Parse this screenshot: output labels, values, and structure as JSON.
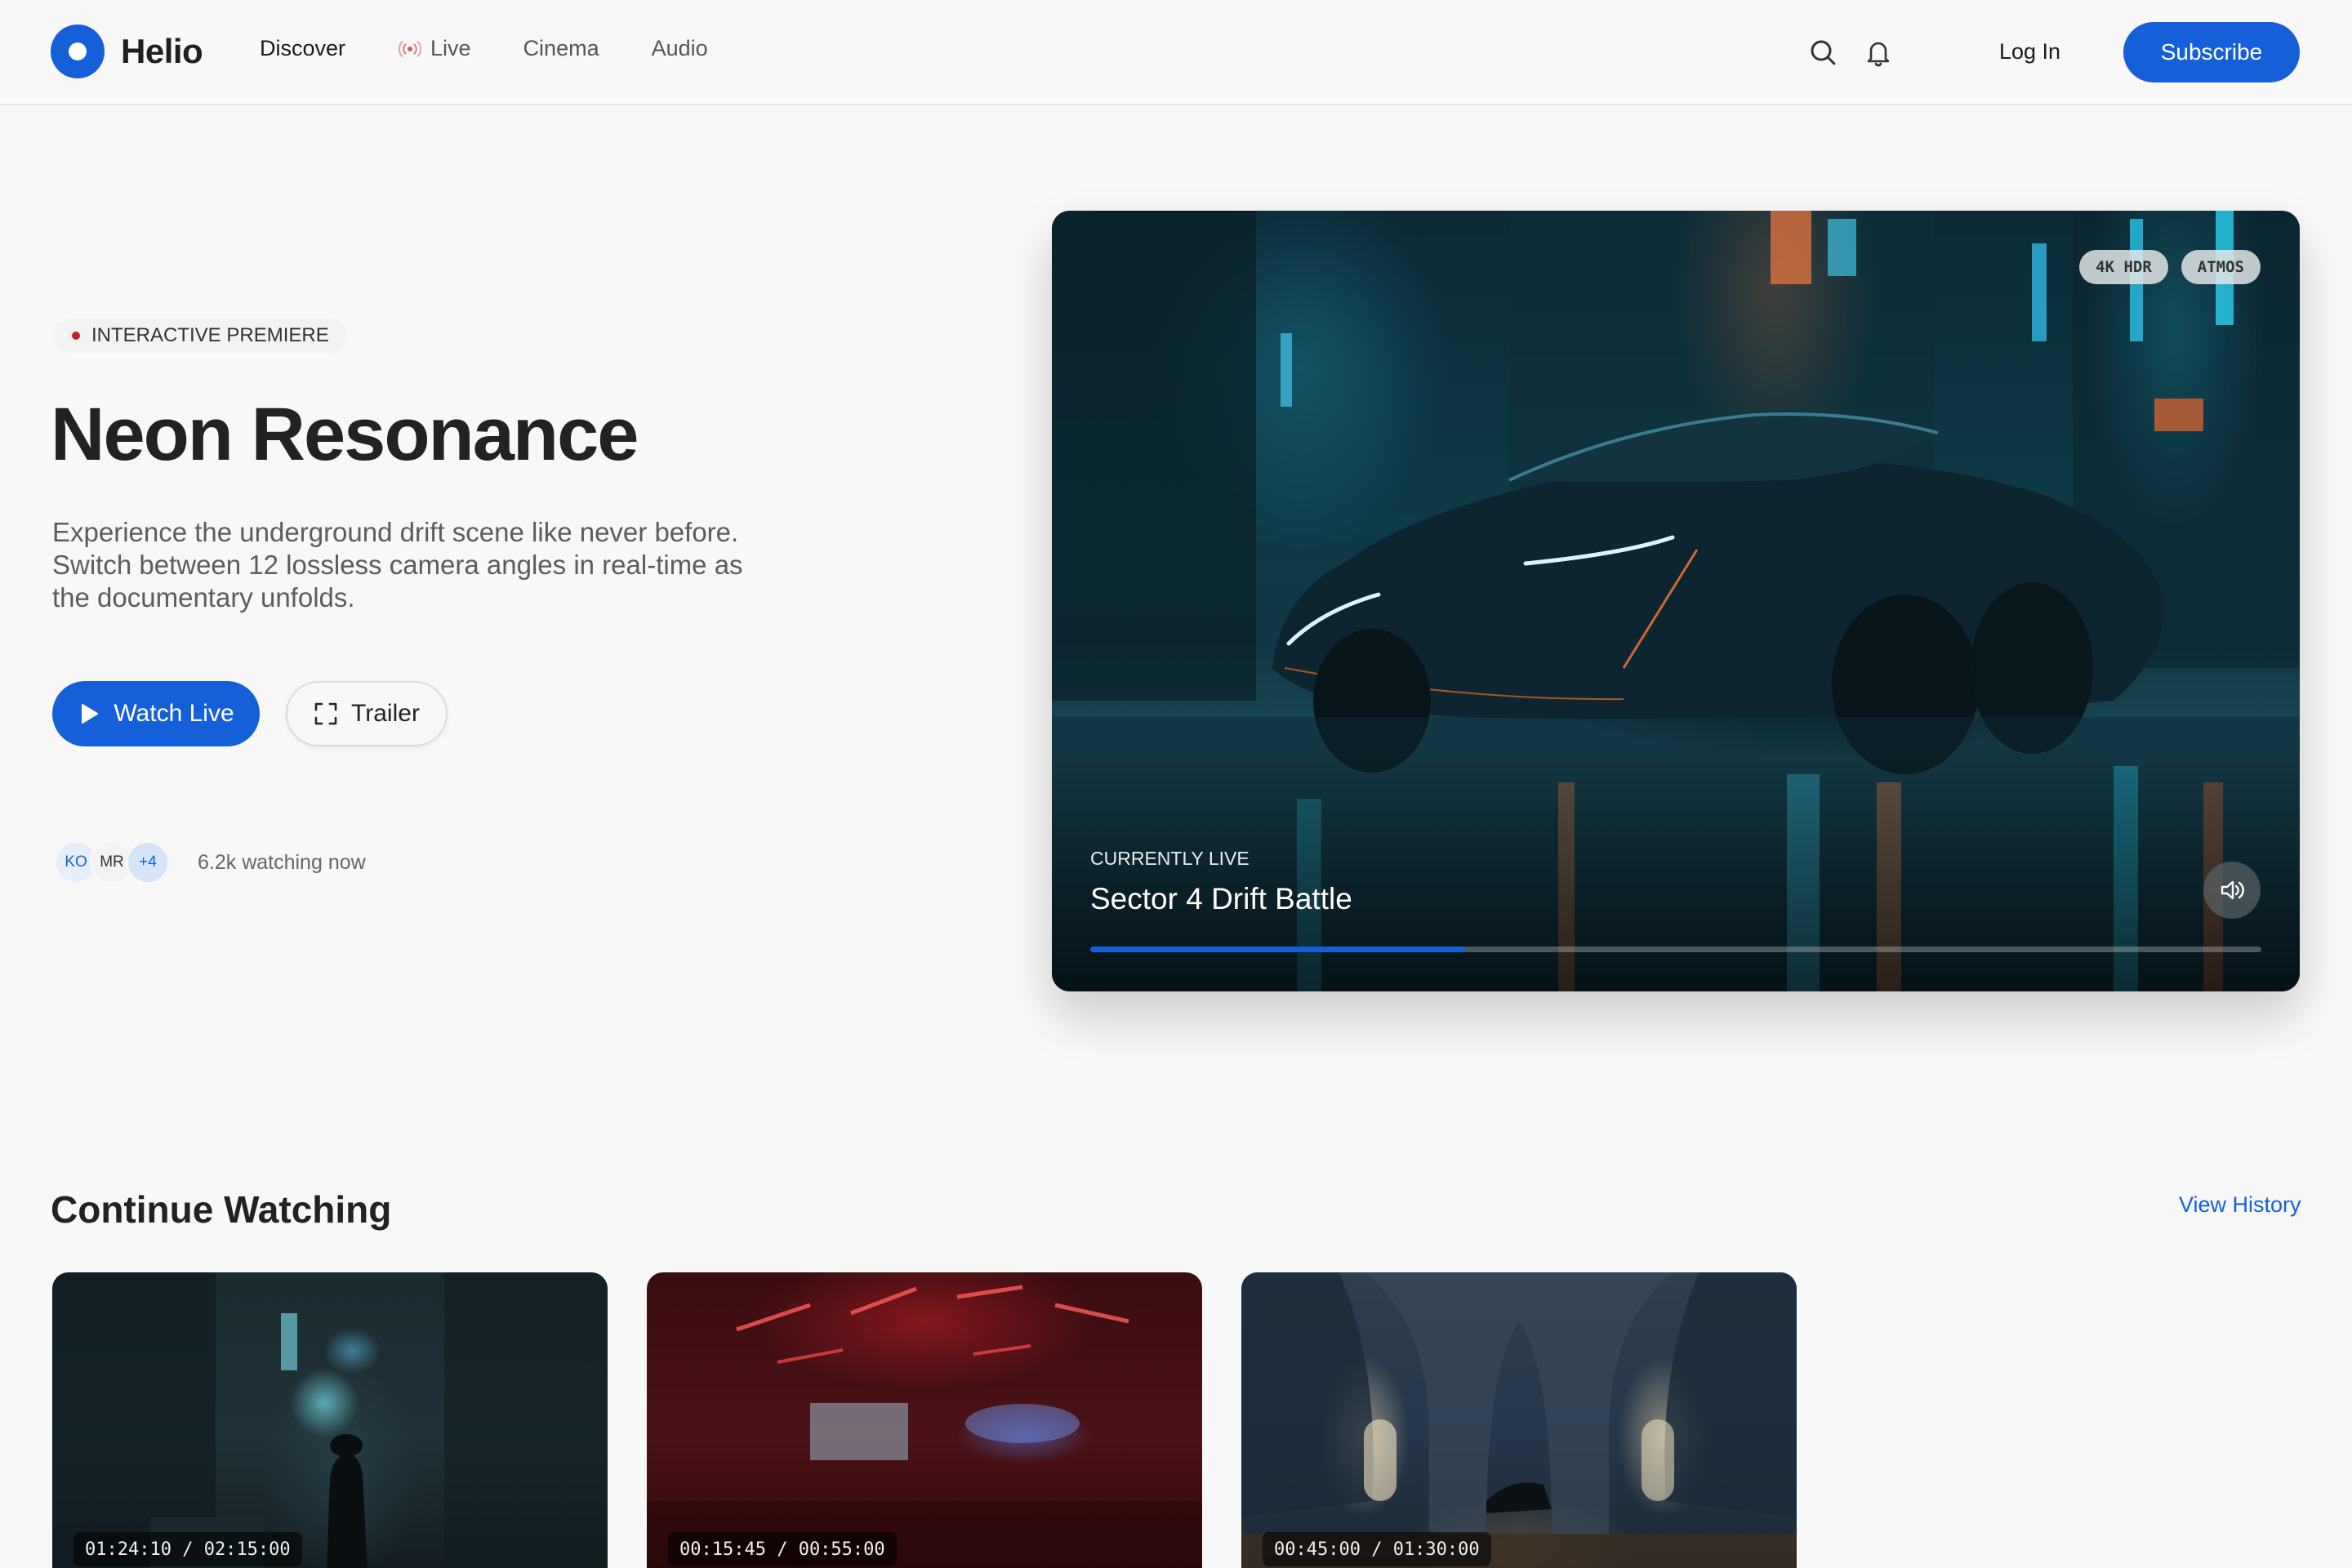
{
  "brand": {
    "name": "Helio",
    "accent": "#1560d9"
  },
  "nav": {
    "items": [
      {
        "label": "Discover",
        "icon": ""
      },
      {
        "label": "Live",
        "icon": "broadcast-icon"
      },
      {
        "label": "Cinema",
        "icon": ""
      },
      {
        "label": "Audio",
        "icon": ""
      }
    ]
  },
  "header": {
    "search_icon": "search-icon",
    "bell_icon": "bell-icon",
    "login_label": "Log In",
    "subscribe_label": "Subscribe"
  },
  "hero": {
    "badge": "INTERACTIVE PREMIERE",
    "title": "Neon Resonance",
    "description": "Experience the underground drift scene like never before. Switch between 12 lossless camera angles in real-time as the documentary unfolds.",
    "watch_label": "Watch Live",
    "trailer_label": "Trailer",
    "viewers": {
      "avatars": [
        "KO",
        "MR",
        "+4"
      ],
      "count_text": "6.2k watching now"
    }
  },
  "player": {
    "tags": [
      "4K HDR",
      "ATMOS"
    ],
    "status": "CURRENTLY LIVE",
    "title": "Sector 4 Drift Battle",
    "progress": 0.32
  },
  "continue_watching": {
    "title": "Continue Watching",
    "view_history_label": "View History",
    "items": [
      {
        "timecode": "01:24:10 / 02:15:00"
      },
      {
        "timecode": "00:15:45 / 00:55:00"
      },
      {
        "timecode": "00:45:00 / 01:30:00"
      }
    ]
  }
}
